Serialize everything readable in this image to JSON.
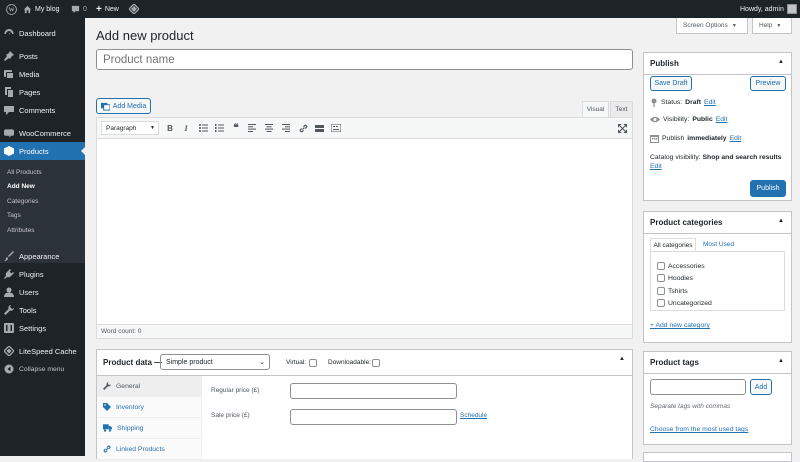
{
  "adminbar": {
    "site_name": "My blog",
    "comments_count": "0",
    "new_label": "New",
    "greeting": "Howdy, admin"
  },
  "sidebar": {
    "items": [
      {
        "label": "Dashboard",
        "icon": "dashboard-icon"
      },
      {
        "label": "Posts",
        "icon": "pin-icon"
      },
      {
        "label": "Media",
        "icon": "media-icon"
      },
      {
        "label": "Pages",
        "icon": "page-icon"
      },
      {
        "label": "Comments",
        "icon": "comment-icon"
      },
      {
        "label": "WooCommerce",
        "icon": "woocommerce-icon"
      },
      {
        "label": "Products",
        "icon": "product-icon"
      },
      {
        "label": "Appearance",
        "icon": "brush-icon"
      },
      {
        "label": "Plugins",
        "icon": "plug-icon"
      },
      {
        "label": "Users",
        "icon": "user-icon"
      },
      {
        "label": "Tools",
        "icon": "wrench-icon"
      },
      {
        "label": "Settings",
        "icon": "settings-icon"
      },
      {
        "label": "LiteSpeed Cache",
        "icon": "diamond-icon"
      },
      {
        "label": "Collapse menu",
        "icon": "collapse-icon"
      }
    ],
    "products_sub": [
      "All Products",
      "Add New",
      "Categories",
      "Tags",
      "Attributes"
    ]
  },
  "screen_options": "Screen Options",
  "help": "Help",
  "page_title": "Add new product",
  "title_placeholder": "Product name",
  "editor": {
    "add_media": "Add Media",
    "tab_visual": "Visual",
    "tab_text": "Text",
    "format": "Paragraph",
    "word_count": "Word count: 0"
  },
  "publish": {
    "title": "Publish",
    "save_draft": "Save Draft",
    "preview": "Preview",
    "status_label": "Status:",
    "status_value": "Draft",
    "visibility_label": "Visibility:",
    "visibility_value": "Public",
    "publish_label": "Publish",
    "publish_value": "immediately",
    "catalog_label": "Catalog visibility:",
    "catalog_value": "Shop and search results",
    "edit": "Edit",
    "publish_button": "Publish"
  },
  "categories": {
    "title": "Product categories",
    "tab_all": "All categories",
    "tab_most": "Most Used",
    "items": [
      "Accessories",
      "Hoodies",
      "Tshirts",
      "Uncategorized"
    ],
    "add_new": "+ Add new category"
  },
  "tags": {
    "title": "Product tags",
    "add": "Add",
    "hint": "Separate tags with commas",
    "choose": "Choose from the most used tags"
  },
  "product_data": {
    "title": "Product data —",
    "type": "Simple product",
    "virtual": "Virtual:",
    "downloadable": "Downloadable:",
    "tabs": [
      {
        "label": "General",
        "icon": "wrench-icon"
      },
      {
        "label": "Inventory",
        "icon": "tag-icon"
      },
      {
        "label": "Shipping",
        "icon": "truck-icon"
      },
      {
        "label": "Linked Products",
        "icon": "link-icon"
      }
    ],
    "regular_price": "Regular price (£)",
    "sale_price": "Sale price (£)",
    "schedule": "Schedule"
  }
}
